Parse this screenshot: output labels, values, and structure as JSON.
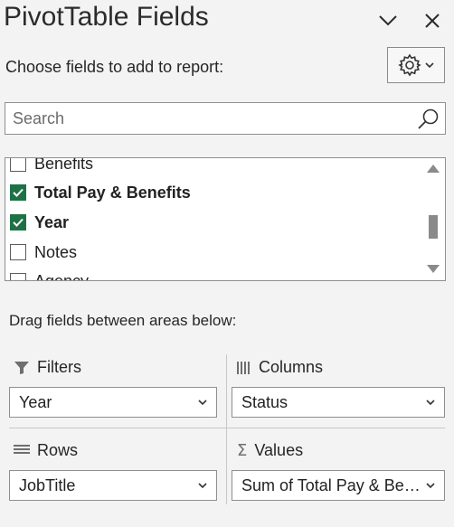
{
  "panel": {
    "title": "PivotTable Fields",
    "subtitle": "Choose fields to add to report:",
    "search_placeholder": "Search",
    "header_icons": [
      "chevron-down-icon",
      "close-icon"
    ],
    "gear_icons": [
      "gear-icon",
      "chevron-down-icon"
    ]
  },
  "fields": [
    {
      "label": "Benefits",
      "checked": false
    },
    {
      "label": "Total Pay & Benefits",
      "checked": true
    },
    {
      "label": "Year",
      "checked": true
    },
    {
      "label": "Notes",
      "checked": false
    },
    {
      "label": "Agency",
      "checked": false
    }
  ],
  "areas": {
    "drag_label": "Drag fields between areas below:",
    "filters": {
      "label": "Filters",
      "icon": "filter-icon",
      "value": "Year"
    },
    "columns": {
      "label": "Columns",
      "icon": "columns-icon",
      "value": "Status"
    },
    "rows": {
      "label": "Rows",
      "icon": "rows-icon",
      "value": "JobTitle"
    },
    "values": {
      "label": "Values",
      "icon": "sigma-icon",
      "value": "Sum of Total Pay & Ben..."
    }
  },
  "colors": {
    "accent": "#1e7145",
    "background": "#f3f3f3"
  }
}
